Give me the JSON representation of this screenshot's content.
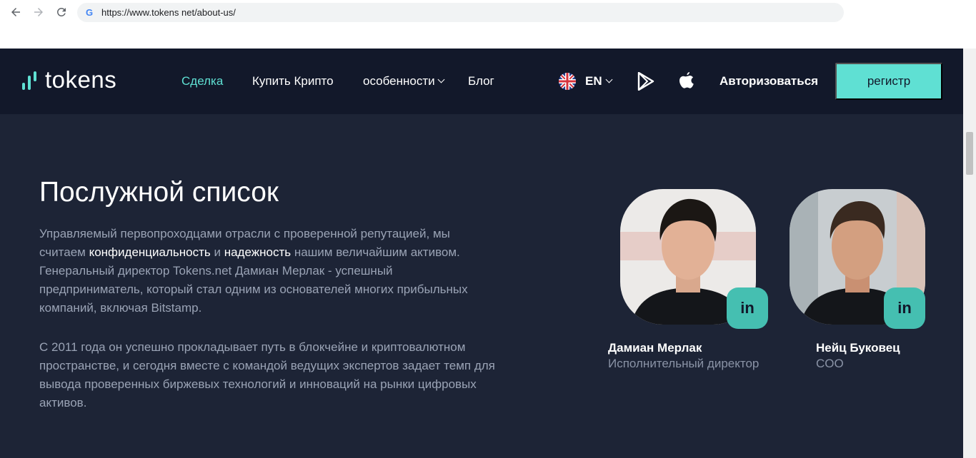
{
  "browser": {
    "url": "https://www.tokens net/about-us/"
  },
  "header": {
    "logo_text": "tokens",
    "nav": [
      {
        "label": "Сделка",
        "active": true
      },
      {
        "label": "Купить Крипто",
        "active": false
      },
      {
        "label": "особенности",
        "active": false,
        "dropdown": true
      },
      {
        "label": "Блог",
        "active": false
      }
    ],
    "language": "EN",
    "login_label": "Авторизоваться",
    "register_label": "регистр"
  },
  "main": {
    "heading": "Послужной список",
    "p1": {
      "a": "Управляемый первопроходцами отрасли с проверенной репутацией, мы считаем ",
      "b": "конфиденциальность",
      "c": " и ",
      "d": "надежность",
      "e": " нашим величайшим активом. Генеральный директор Tokens.net Дамиан Мерлак - успешный предприниматель, который стал одним из основателей многих прибыльных компаний, включая Bitstamp."
    },
    "p2": "С 2011 года он успешно прокладывает путь в блокчейне и криптовалютном пространстве, и сегодня вместе с командой ведущих экспертов задает темп для вывода проверенных биржевых технологий и инноваций на рынки цифровых активов."
  },
  "team": [
    {
      "name": "Дамиан Мерлак",
      "role": "Исполнительный директор",
      "badge": "in"
    },
    {
      "name": "Нейц Буковец",
      "role": "COO",
      "badge": "in"
    }
  ],
  "colors": {
    "accent": "#5fe0d3",
    "header_bg": "#12182a",
    "page_bg": "#1d2436"
  }
}
